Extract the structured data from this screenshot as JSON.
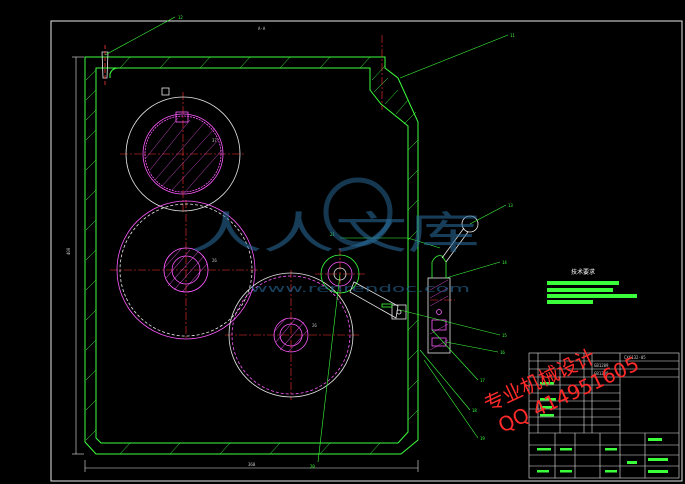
{
  "drawing": {
    "title_label": "A-A",
    "dim_width": "360",
    "dim_height": "400",
    "part_numbers": [
      "12",
      "11",
      "13",
      "14",
      "15",
      "16",
      "17",
      "18",
      "19",
      "20",
      "21"
    ],
    "gear_labels": [
      "37",
      "26",
      "26"
    ]
  },
  "requirements": {
    "title": "技术要求"
  },
  "title_block": {
    "drawing_number": "CX6132-05",
    "std_1": "GB1209",
    "std_2": "GB1209"
  },
  "watermarks": {
    "site_logo_text": "人人文库",
    "site_url": "www.renrendoc.com",
    "overlay_line1": "专业机械设计",
    "overlay_line2": "QQ 414951605"
  },
  "colors": {
    "background": "#000000",
    "outline": "#3cff3c",
    "centerline": "#ff3030",
    "gear_pink": "#ff5aff",
    "gear_white": "#e8e8e8",
    "leader": "#3cff3c",
    "watermark_blue": "#2a6fa0",
    "overlay_red": "#ff2a2a"
  }
}
